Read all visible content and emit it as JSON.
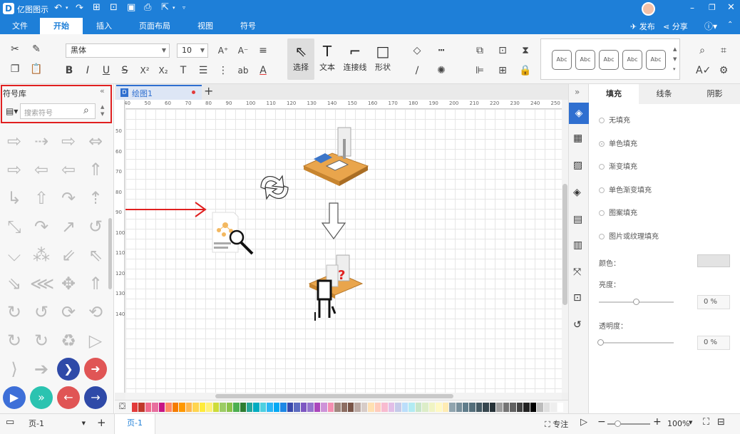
{
  "app": {
    "title": "亿图图示"
  },
  "header": {
    "publish": "发布",
    "share": "分享"
  },
  "menu": {
    "items": [
      {
        "label": "文件"
      },
      {
        "label": "开始"
      },
      {
        "label": "插入"
      },
      {
        "label": "页面布局"
      },
      {
        "label": "视图"
      },
      {
        "label": "符号"
      }
    ]
  },
  "ribbon": {
    "font_name": "黑体",
    "font_size": "10",
    "tools": [
      {
        "label": "选择"
      },
      {
        "label": "文本"
      },
      {
        "label": "连接线"
      },
      {
        "label": "形状"
      }
    ],
    "styles": [
      "Abc",
      "Abc",
      "Abc",
      "Abc",
      "Abc"
    ]
  },
  "library": {
    "title": "符号库",
    "search_placeholder": "搜索符号"
  },
  "doc": {
    "tab": "绘图1"
  },
  "ruler": {
    "h": [
      "40",
      "50",
      "60",
      "70",
      "80",
      "90",
      "100",
      "110",
      "120",
      "130",
      "140",
      "150",
      "160",
      "170",
      "180",
      "190",
      "200",
      "210",
      "220",
      "230",
      "240",
      "250"
    ],
    "v": [
      "50",
      "60",
      "70",
      "80",
      "90",
      "100",
      "110",
      "120",
      "130",
      "140"
    ]
  },
  "panel": {
    "tabs": [
      "填充",
      "线条",
      "阴影"
    ],
    "fill_options": [
      {
        "label": "无填充",
        "selected": false
      },
      {
        "label": "单色填充",
        "selected": true
      },
      {
        "label": "渐变填充",
        "selected": false
      },
      {
        "label": "单色渐变填充",
        "selected": false
      },
      {
        "label": "图案填充",
        "selected": false
      },
      {
        "label": "图片或纹理填充",
        "selected": false
      }
    ],
    "color_label": "颜色：",
    "brightness_label": "亮度：",
    "brightness_value": "0 %",
    "transparency_label": "透明度：",
    "transparency_value": "0 %"
  },
  "status": {
    "page_select": "页-1",
    "page_tab": "页-1",
    "focus": "专注",
    "zoom": "100%"
  },
  "palette": [
    "#e23b3b",
    "#c0392b",
    "#f06a8c",
    "#e86f9e",
    "#c71585",
    "#ff8a65",
    "#f57c00",
    "#ff9800",
    "#ffb74d",
    "#ffd54f",
    "#ffeb3b",
    "#fff176",
    "#cddc39",
    "#9ccc65",
    "#8bc34a",
    "#4caf50",
    "#2e7d32",
    "#26a69a",
    "#00acc1",
    "#4dd0e1",
    "#29b6f6",
    "#03a9f4",
    "#1e88e5",
    "#3949ab",
    "#5c6bc0",
    "#7e57c2",
    "#9575cd",
    "#ab47bc",
    "#ce93d8",
    "#f48fb1",
    "#a1887f",
    "#8d6e63",
    "#795548",
    "#bcaaa4",
    "#d7ccc8",
    "#ffe0b2",
    "#ffccbc",
    "#f8bbd0",
    "#e1bee7",
    "#c5cae9",
    "#bbdefb",
    "#b2ebf2",
    "#c8e6c9",
    "#dcedc8",
    "#f0f4c3",
    "#fff9c4",
    "#ffecb3",
    "#90a4ae",
    "#78909c",
    "#607d8b",
    "#546e7a",
    "#455a64",
    "#37474f",
    "#263238",
    "#9e9e9e",
    "#757575",
    "#616161",
    "#424242",
    "#212121",
    "#000000",
    "#bdbdbd",
    "#e0e0e0",
    "#eeeeee",
    "#ffffff"
  ]
}
